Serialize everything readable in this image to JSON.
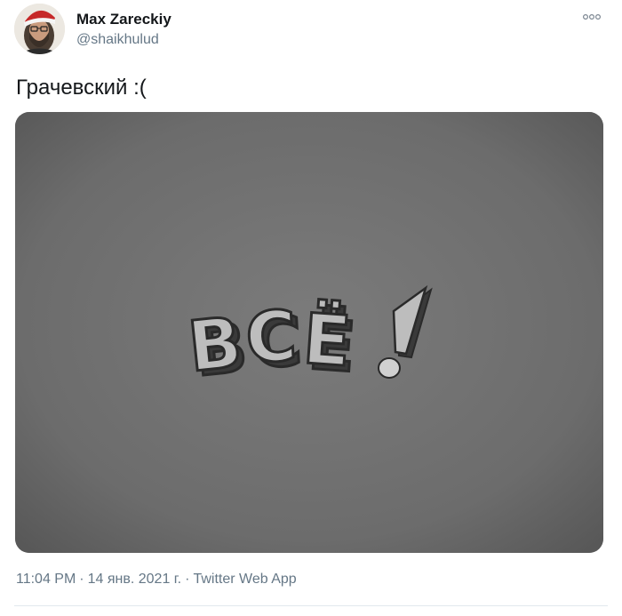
{
  "author": {
    "display_name": "Max Zareckiy",
    "handle": "@shaikhulud"
  },
  "tweet": {
    "text": "Грачевский :("
  },
  "media": {
    "caption_art": "ВСЁ!"
  },
  "meta": {
    "time": "11:04 PM",
    "date": "14 янв. 2021 г.",
    "source": "Twitter Web App",
    "separator": "·"
  },
  "icons": {
    "more": "more-icon"
  },
  "colors": {
    "secondary_text": "#657786",
    "image_background": "#6e6e6e"
  }
}
